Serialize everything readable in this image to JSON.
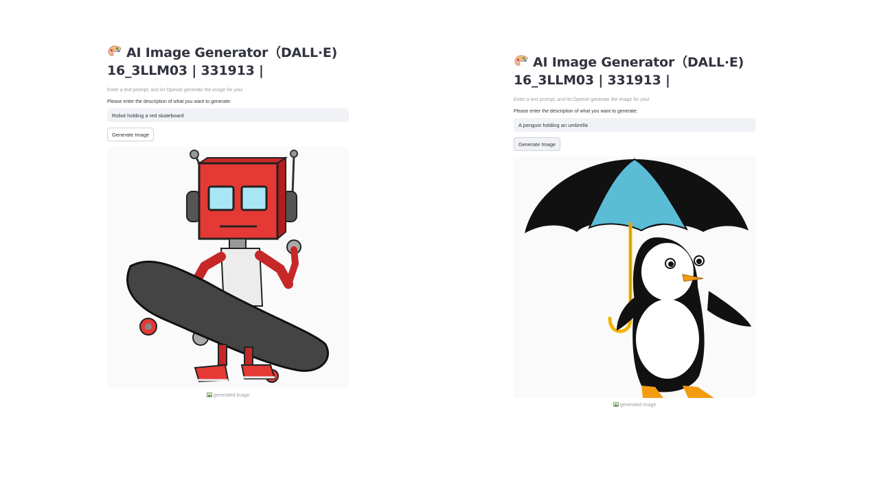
{
  "panels": [
    {
      "title_line1": "AI Image Generator（DALL·E)",
      "title_line2": "16_3LLM03 | 331913 |",
      "subtitle": "Enter a text prompt, and let OpenAI generate the image for you!",
      "input_label": "Please enter the description of what you want to generate:",
      "prompt_value": "Robot holding a red skateboard",
      "button_label": "Generate Image",
      "caption": "generated image",
      "image_icon": "robot-skateboard-image"
    },
    {
      "title_line1": "AI Image Generator（DALL·E)",
      "title_line2": "16_3LLM03 | 331913 |",
      "subtitle": "Enter a text prompt, and let OpenAI generate the image for you!",
      "input_label": "Please enter the description of what you want to generate:",
      "prompt_value": "A penguin holding an umbrella",
      "button_label": "Generate Image",
      "caption": "generated image",
      "image_icon": "penguin-umbrella-image"
    }
  ],
  "colors": {
    "text": "#31333f",
    "muted": "#9a9ca6",
    "input_bg": "#f0f2f6",
    "robot_red": "#e53935",
    "umbrella_blue": "#5bbcd6",
    "umbrella_handle": "#f4b400"
  }
}
